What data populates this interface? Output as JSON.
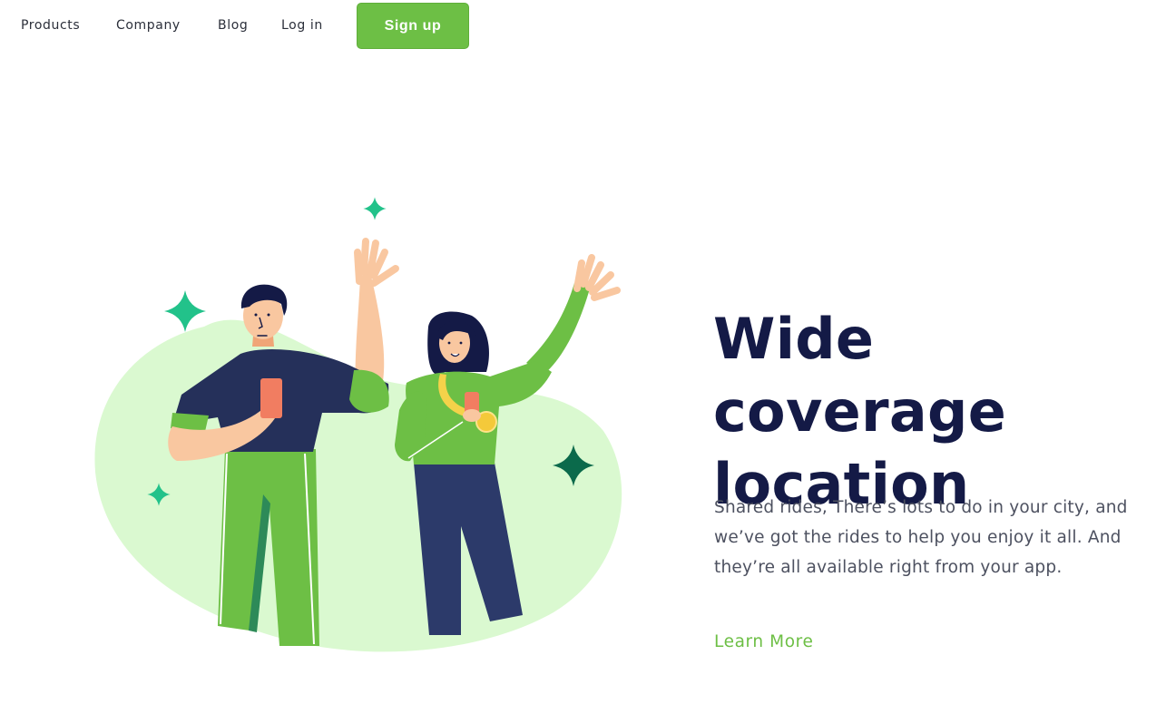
{
  "nav": {
    "products": "Products",
    "company": "Company",
    "blog": "Blog",
    "login": "Log in",
    "signup": "Sign up"
  },
  "hero": {
    "headline_line1": "Wide coverage",
    "headline_line2": "location",
    "description": "Shared rides, There’s lots to do in your city, and we’ve got the rides to help you enjoy it all. And they’re all available right from your app.",
    "cta": "Learn More"
  },
  "colors": {
    "brand_green": "#6dbf45",
    "headline_navy": "#141a46",
    "body_text": "#4d5160",
    "blob_mint": "#daf9d0"
  },
  "icons": {
    "sparkle": "sparkle-icon"
  }
}
